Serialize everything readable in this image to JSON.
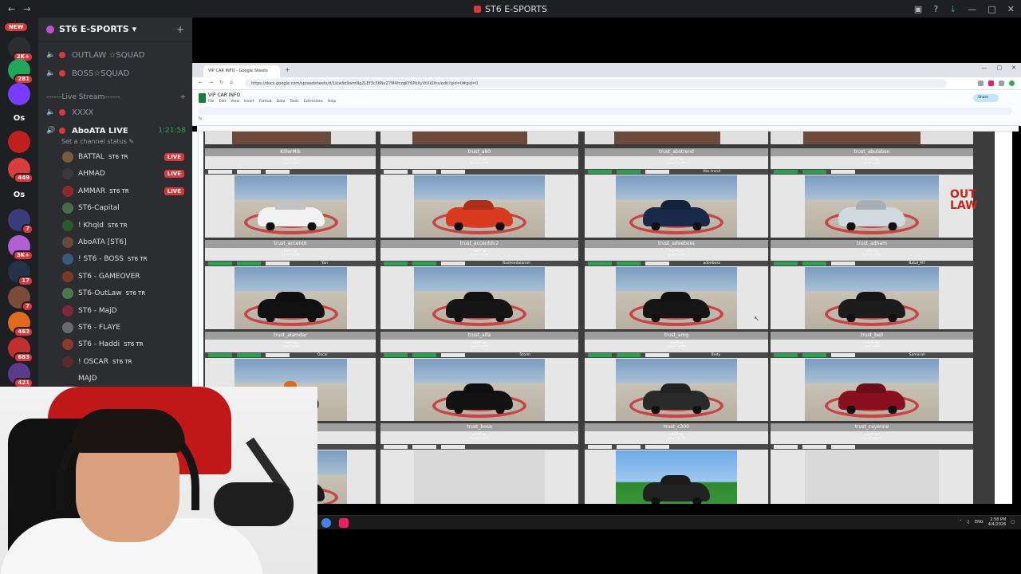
{
  "window": {
    "title": "ST6 E-SPORTS",
    "accent": "#da373c"
  },
  "rail": {
    "new_badge": "NEW",
    "servers": [
      {
        "label": "2K+",
        "color": "#2b2d31"
      },
      {
        "label": "281",
        "color": "#23a55a"
      },
      {
        "label": "",
        "color": "#7a3cff"
      },
      {
        "label": "Os",
        "color": "#1e1f22"
      },
      {
        "label": "",
        "color": "#c0201d"
      },
      {
        "label": "449",
        "color": "#d83c3c"
      },
      {
        "label": "Os",
        "color": "#1e1f22"
      },
      {
        "label": "7",
        "color": "#3a3c7a"
      },
      {
        "label": "3K+",
        "color": "#b060d0"
      },
      {
        "label": "17",
        "color": "#24324a"
      },
      {
        "label": "7",
        "color": "#7a4a3a"
      },
      {
        "label": "463",
        "color": "#e06a20"
      },
      {
        "label": "683",
        "color": "#c03030"
      },
      {
        "label": "421",
        "color": "#5a3c8a"
      },
      {
        "label": "700",
        "color": "#d82a6a"
      },
      {
        "label": "906",
        "color": "#2a4ab0"
      },
      {
        "label": "1K+",
        "color": "#d83030"
      }
    ]
  },
  "sidebar": {
    "server_name": "ST6 E-SPORTS",
    "channels": [
      {
        "name": "OUTLAW ☆SQUAD"
      },
      {
        "name": "BOSS☆SQUAD"
      }
    ],
    "category": "------Live Stream------",
    "voice_channels": [
      {
        "name": "XXXX"
      }
    ],
    "active_channel": {
      "name": "AboATA LIVE",
      "time": "1:21:58"
    },
    "status_prompt": "Set a channel status",
    "members": [
      {
        "name": "BATTAL",
        "tag": "ST6 TR",
        "badge": "LIVE",
        "avatar": "#7a5a3a"
      },
      {
        "name": "AHMAD",
        "tag": "",
        "badge": "LIVE",
        "avatar": "#3a3a3a"
      },
      {
        "name": "AMMAR",
        "tag": "ST6 TR",
        "badge": "LIVE",
        "avatar": "#8a2a2a"
      },
      {
        "name": "ST6-Capital",
        "tag": "",
        "badge": "",
        "avatar": "#4a6a4a"
      },
      {
        "name": "! Khqld",
        "tag": "ST6 TR",
        "badge": "",
        "avatar": "#2a5a2a"
      },
      {
        "name": "AboATA [ST6]",
        "tag": "",
        "badge": "",
        "avatar": "#6a4a3a"
      },
      {
        "name": "! ST6 - BOSS",
        "tag": "ST6 TR",
        "badge": "",
        "avatar": "#3a5a7a"
      },
      {
        "name": "ST6 - GAMEOVER",
        "tag": "",
        "badge": "",
        "avatar": "#7a3a2a"
      },
      {
        "name": "ST6-OutLaw",
        "tag": "ST6 TR",
        "badge": "",
        "avatar": "#4a7a4a"
      },
      {
        "name": "ST6 - MajD",
        "tag": "",
        "badge": "",
        "avatar": "#7a2a3a"
      },
      {
        "name": "ST6 - FLAYE",
        "tag": "",
        "badge": "",
        "avatar": "#6a6a6a"
      },
      {
        "name": "ST6 - Haddi",
        "tag": "ST6 TR",
        "badge": "",
        "avatar": "#8a3a2a"
      },
      {
        "name": "! OSCAR",
        "tag": "ST6 TR",
        "badge": "",
        "avatar": "#5a2a2a"
      },
      {
        "name": "MAJD",
        "tag": "",
        "badge": "",
        "avatar": "#2b2d31"
      }
    ]
  },
  "browser": {
    "tab_title": "VIP CAR INFO - Google Sheets",
    "url": "https://docs.google.com/spreadsheets/d/1kiw9z9wmNqZLEf3c56NvZ7M4fczqKY6PkXyVtXkDhs/edit?gid=0#gid=0",
    "doc_title": "VIP CAR INFO",
    "menus": [
      "File",
      "Edit",
      "View",
      "Insert",
      "Format",
      "Data",
      "Tools",
      "Extensions",
      "Help"
    ],
    "share_label": "Share"
  },
  "sheet": {
    "cards": [
      {
        "name": "KillerMik",
        "owner": "",
        "tags": "white",
        "car": "#f2f2f2",
        "photo": "normal"
      },
      {
        "name": "trust_a80",
        "owner": "",
        "tags": "white",
        "car": "#d83a1e",
        "photo": "normal"
      },
      {
        "name": "trust_abstrend",
        "owner": "Abs trend",
        "tags": "green",
        "car": "#1a2a4a",
        "photo": "normal"
      },
      {
        "name": "trust_abulaban",
        "owner": "",
        "tags": "green",
        "car": "#d0d8e0",
        "photo": "normal"
      },
      {
        "name": "trust_accent6",
        "owner": "Yari",
        "tags": "green",
        "car": "#111111",
        "photo": "normal"
      },
      {
        "name": "trust_accentdv2",
        "owner": "Rasheedalamm",
        "tags": "green",
        "car": "#151515",
        "photo": "normal"
      },
      {
        "name": "trust_adeeboss",
        "owner": "adeeboss",
        "tags": "green",
        "car": "#161616",
        "photo": "normal"
      },
      {
        "name": "trust_adham",
        "owner": "Batal_M7",
        "tags": "green",
        "car": "#1c1c1c",
        "photo": "normal"
      },
      {
        "name": "trust_alamdar",
        "owner": "Oscar",
        "tags": "green",
        "car": "",
        "photo": "bike"
      },
      {
        "name": "trust_alfa",
        "owner": "Storm",
        "tags": "green",
        "car": "#121212",
        "photo": "normal"
      },
      {
        "name": "trust_amg",
        "owner": "Body",
        "tags": "green",
        "car": "#2a2a2a",
        "photo": "normal"
      },
      {
        "name": "trust_bell",
        "owner": "Samarah",
        "tags": "green",
        "car": "#8a1020",
        "photo": "normal"
      },
      {
        "name": "trust_boss",
        "owner": "",
        "tags": "white",
        "car": "#1a1a1a",
        "photo": "normal"
      },
      {
        "name": "trust_bosa",
        "owner": "",
        "tags": "white",
        "car": "",
        "photo": "empty"
      },
      {
        "name": "trust_c300",
        "owner": "",
        "tags": "white",
        "car": "#222222",
        "photo": "green"
      },
      {
        "name": "trust_cayenne",
        "owner": "",
        "tags": "white",
        "car": "",
        "photo": "empty"
      }
    ],
    "sub_line1": "نوع السيارة",
    "sub_line2": "تفاصيل السيارة"
  },
  "watermark": {
    "line1": "OUT",
    "line2": "LAW"
  },
  "taskbar": {
    "lang": "ENG",
    "time": "2:58 PM",
    "date": "4/4/2026"
  }
}
